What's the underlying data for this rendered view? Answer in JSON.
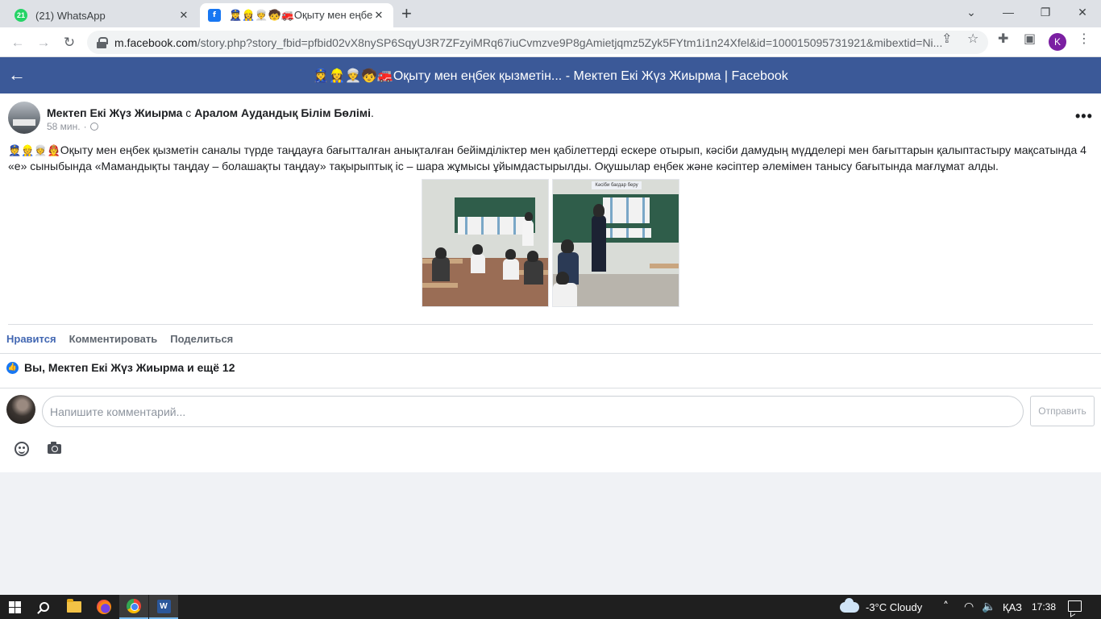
{
  "browser": {
    "tabs": [
      {
        "title": "(21) WhatsApp",
        "badge": "21",
        "active": false
      },
      {
        "title": "👮‍♀️👷‍♀️👳‍♀️🧒🚒Оқыту мен еңбек",
        "active": true
      }
    ],
    "url_host": "m.facebook.com",
    "url_rest": "/story.php?story_fbid=pfbid02vX8nySP6SqyU3R7ZFzyiMRq67iuCvmzve9P8gAmietjqmz5Zyk5FYtm1i1n24Xfel&id=100015095731921&mibextid=Ni...",
    "profile_initial": "K"
  },
  "fb_header": {
    "title": "👮‍♀️👷‍♀️👳‍♀️🧒🚒Оқыту мен еңбек қызметін... - Мектеп Екі Жүз Жиырма | Facebook"
  },
  "post": {
    "author": "Мектеп Екі Жүз Жиырма",
    "with_word": " с ",
    "tagged": "Аралом Аудандық Білім Бөлімі",
    "after_tag": ".",
    "time": "58 мин.",
    "separator": " · ",
    "emojis": "👮👷👳🧑‍🚒",
    "text": "Оқыту мен еңбек қызметін саналы түрде таңдауға бағытталған анықталған бейімділіктер мен қабілеттерді ескере отырып, кәсіби дамудың мүдделері мен бағыттарын қалыптастыру мақсатында 4 «е» сыныбында «Мамандықты таңдау – болашақты таңдау» тақырыптық іс – шара жұмысы ұйымдастырылды. Оқушылар еңбек және кәсіптер әлемімен танысу бағытында мағлұмат алды.",
    "photo2_caption": "Кәсіби бағдар беру"
  },
  "actions": {
    "like": "Нравится",
    "comment": "Комментировать",
    "share": "Поделиться"
  },
  "likes_summary": "Вы, Мектеп Екі Жүз Жиырма и ещё 12",
  "comment_box": {
    "placeholder": "Напишите комментарий...",
    "send_label": "Отправить"
  },
  "taskbar": {
    "weather": "-3°C  Cloudy",
    "language": "ҚАЗ",
    "time": "17:38"
  },
  "colors": {
    "fb_header": "#3b5998",
    "link_blue": "#4267b2",
    "chrome_tabstrip": "#dee1e6",
    "taskbar": "#1f1f1f"
  }
}
